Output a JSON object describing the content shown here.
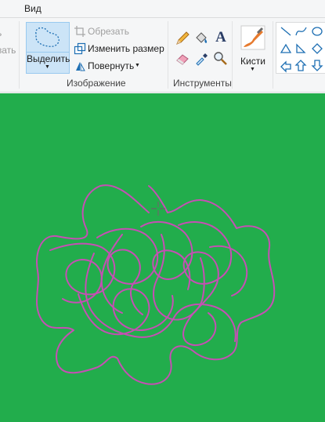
{
  "tabs": {
    "view_label": "Вид"
  },
  "clipboard_partial": {
    "line1": "ь",
    "line2": "вать"
  },
  "image_group": {
    "select_label": "Выделить",
    "crop_label": "Обрезать",
    "resize_label": "Изменить размер",
    "rotate_label": "Повернуть",
    "group_label": "Изображение"
  },
  "tools_group": {
    "group_label": "Инструменты"
  },
  "brushes": {
    "label": "Кисти"
  },
  "colors": {
    "canvas": "#22ad4c",
    "stroke": "#c64fb4",
    "selected_bg": "#cce4f7"
  }
}
